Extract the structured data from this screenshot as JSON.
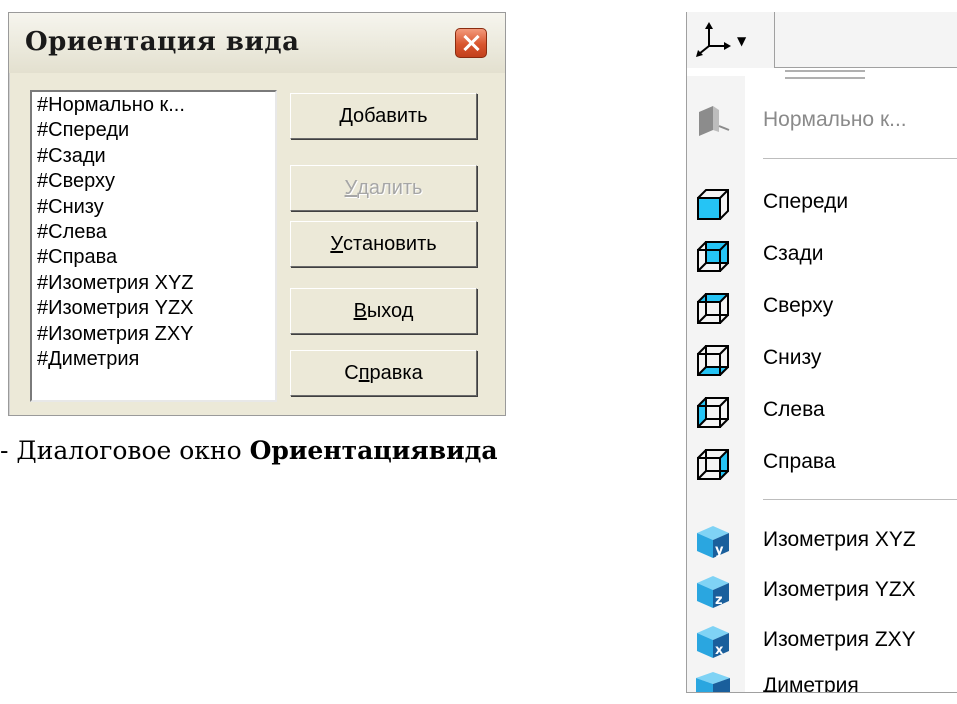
{
  "dialog": {
    "title": "Ориентация вида",
    "list_items": [
      "#Нормально к...",
      "#Спереди",
      "#Сзади",
      "#Сверху",
      "#Снизу",
      "#Слева",
      "#Справа",
      "#Изометрия XYZ",
      "#Изометрия YZX",
      "#Изометрия ZXY",
      "#Диметрия"
    ],
    "buttons": {
      "add": {
        "pre": "",
        "key": "Д",
        "post": "обавить"
      },
      "delete": {
        "pre": "",
        "key": "У",
        "post": "далить"
      },
      "set": {
        "pre": "",
        "key": "У",
        "post": "становить"
      },
      "exit": {
        "pre": "",
        "key": "В",
        "post": "ыход"
      },
      "help": {
        "pre": "С",
        "key": "п",
        "post": "равка"
      }
    }
  },
  "caption": {
    "prefix": "- Диалоговое окно ",
    "bold": "Ориентациявида"
  },
  "toolbar": {
    "button_icon": "axes-icon",
    "menu_items": [
      {
        "label": "Нормально к...",
        "icon": "normal-view-icon"
      },
      {
        "label": "Спереди",
        "icon": "front-view-icon"
      },
      {
        "label": "Сзади",
        "icon": "back-view-icon"
      },
      {
        "label": "Сверху",
        "icon": "top-view-icon"
      },
      {
        "label": "Снизу",
        "icon": "bottom-view-icon"
      },
      {
        "label": "Слева",
        "icon": "left-view-icon"
      },
      {
        "label": "Справа",
        "icon": "right-view-icon"
      },
      {
        "label": "Изометрия XYZ",
        "icon": "isometric-xyz-icon",
        "badge": "y"
      },
      {
        "label": "Изометрия YZX",
        "icon": "isometric-yzx-icon",
        "badge": "z"
      },
      {
        "label": "Изометрия ZXY",
        "icon": "isometric-zxy-icon",
        "badge": "x"
      },
      {
        "label": "Диметрия",
        "icon": "dimetric-icon"
      }
    ]
  },
  "colors": {
    "dialog_bg": "#ece9d8",
    "close_button": "#d8552e",
    "cube_face": "#2aa6e0",
    "cube_dark": "#1a5f9c",
    "disabled_text": "#a6a6a6"
  }
}
